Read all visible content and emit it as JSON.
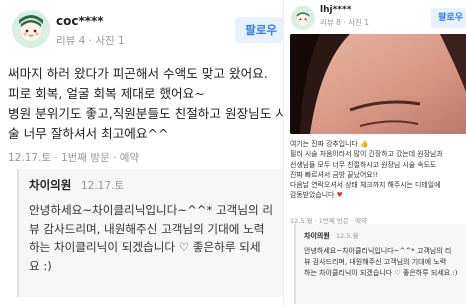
{
  "left_review": {
    "username": "coc****",
    "meta": "리뷰 4 · 사진 1",
    "follow_label": "팔로우",
    "body_lines": [
      "써마지 하러 왔다가 피곤해서 수액도 맞고 왔어요.",
      "피로 회복, 얼굴 회복 제대로 했어요~",
      "병원 분위기도 좋고,직원분들도 친절하고 원장님도 시",
      "술 너무 잘하셔서 최고에요^^"
    ],
    "date_line": "12.17.토 · 1번째 방문 · 예약",
    "reply": {
      "owner": "차이의원",
      "date": "12.17.토",
      "lines": [
        "안녕하세요~차이클리닉입니다~^^* 고객님의 리",
        "뷰 감사드리며, 내원해주신 고객님의 기대에 노력",
        "하는 차이클리닉이 되겠습니다 ♡ 좋은하루 되세",
        "요 :)"
      ]
    }
  },
  "right_review": {
    "username": "lhj****",
    "meta": "리뷰 8 · 사진 1",
    "follow_label": "팔로우",
    "body_lines": [
      "여기는 진짜 강추입니다 👍",
      "필러 시술 처음이라서 많이 긴장하고 갔는데 원장님과",
      "선생님들 모두 너무 친절하시고 원장님 시술 속도도",
      "진짜 빠르셔서 금방 끝났어요!!",
      "다음날 연락오셔서 상태 체크까지 해주시는 디테일에",
      "감동받았습니다"
    ],
    "heart": "♥",
    "date_line": "12.5.월 · 1번째 방문 · 예약",
    "reply": {
      "owner": "차이의원",
      "date": "12.5.월",
      "lines": [
        "안녕하세요~차이클리닉입니다~^^* 고객님의 리",
        "뷰 감사드리며, 내원해주신 고객님의 기대에 노력",
        "하는 차이클리닉이 되겠습니다 ♡ 좋은하루 되세요 :)"
      ]
    }
  },
  "colors": {
    "follow_text": "#2f7cf6",
    "follow_bg": "#e8f1ff",
    "meta_text": "#999999",
    "reply_bg": "#f6f6f6",
    "heart": "#e23b3b"
  },
  "icons": {
    "left_avatar": "cartoon-face-avatar",
    "right_avatar": "cartoon-face-avatar",
    "right_photo": "review-photo-face-closeup"
  }
}
